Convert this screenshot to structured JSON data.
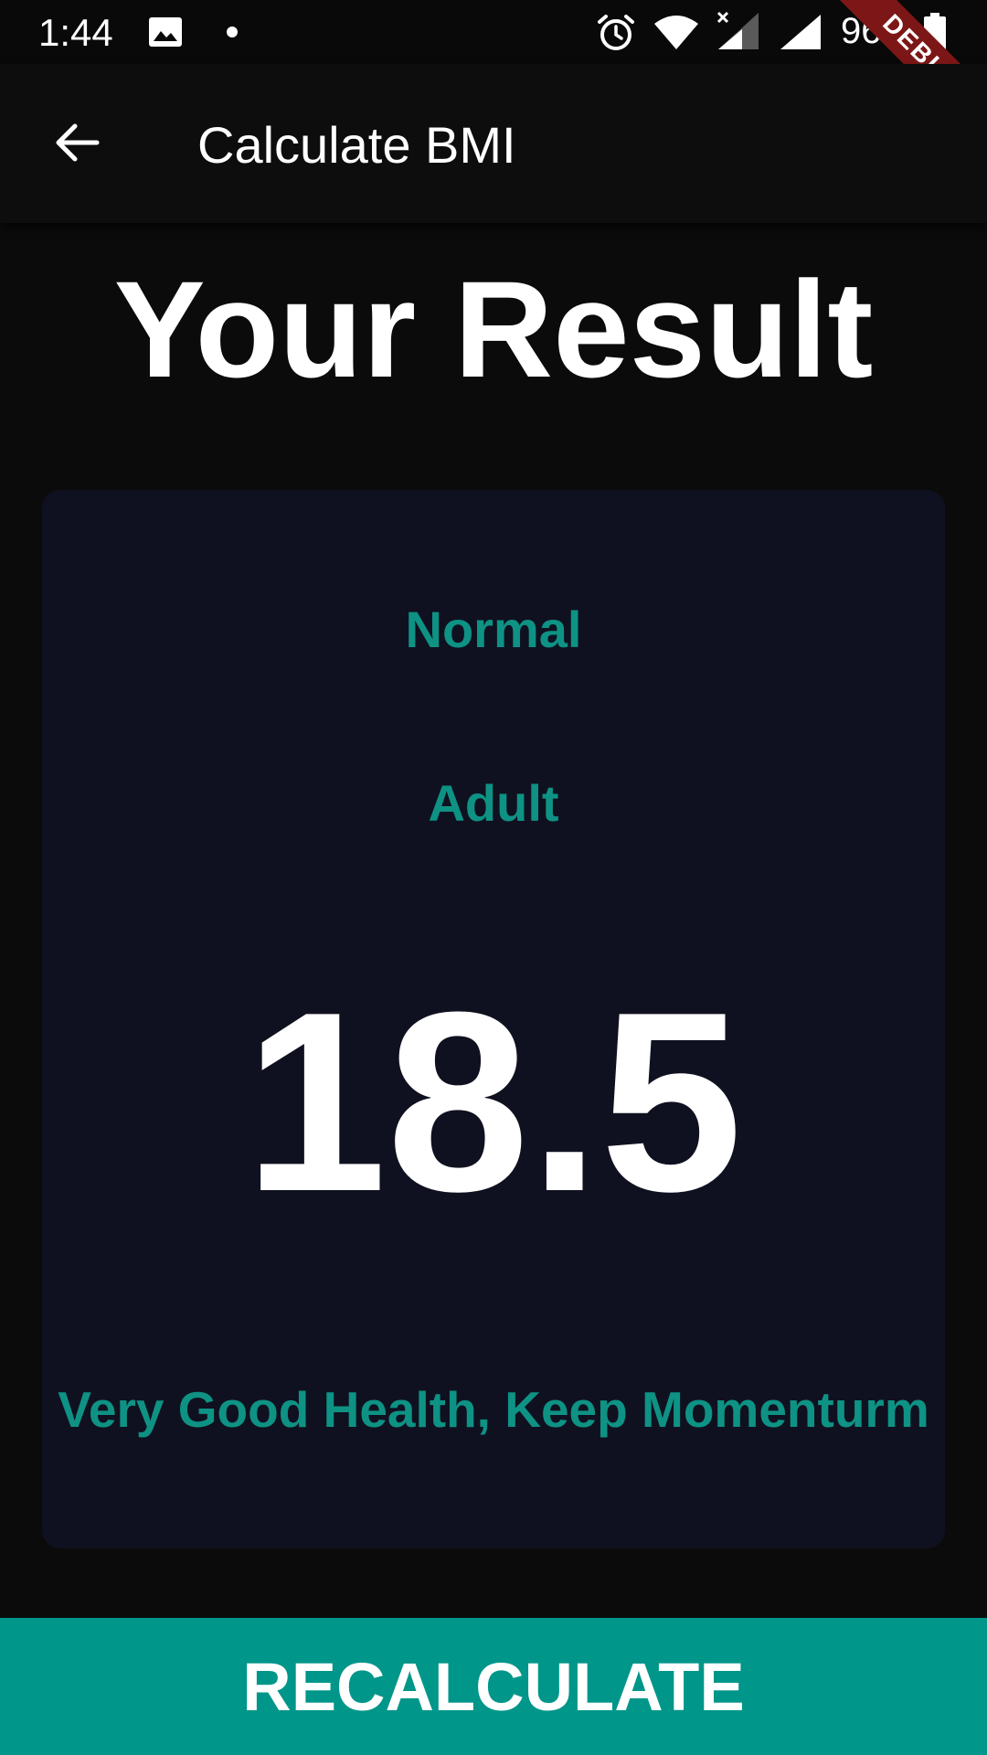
{
  "status_bar": {
    "time": "1:44",
    "battery_percent": "96%",
    "icons": [
      "gallery-icon",
      "dot-icon",
      "alarm-icon",
      "wifi-icon",
      "signal-icon",
      "signal-icon",
      "battery-icon"
    ]
  },
  "debug_banner": {
    "label": "DEBUG"
  },
  "app_bar": {
    "title": "Calculate BMI",
    "back_icon": "arrow-back-icon"
  },
  "heading": "Your Result",
  "result": {
    "category": "Normal",
    "age_group": "Adult",
    "bmi": "18.5",
    "advice": "Very Good Health, Keep Momenturm"
  },
  "button": {
    "label": "RECALCULATE"
  },
  "colors": {
    "accent": "#0e9284",
    "button": "#009689",
    "card": "#101120",
    "background": "#0b0b0b",
    "debug": "#7d1717"
  }
}
